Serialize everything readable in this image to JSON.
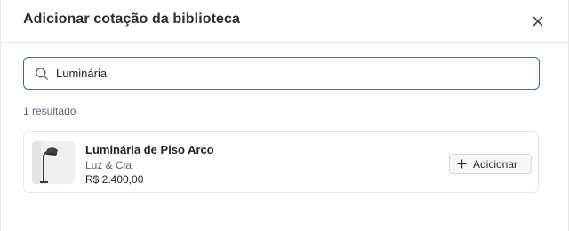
{
  "modal": {
    "title": "Adicionar cotação da biblioteca",
    "close_icon": "close-icon"
  },
  "search": {
    "icon": "search-icon",
    "value": "Luminária",
    "placeholder": ""
  },
  "results": {
    "count_label": "1 resultado",
    "items": [
      {
        "name": "Luminária de Piso Arco",
        "brand": "Luz & Cia",
        "price": "R$ 2.400,00",
        "image": "floor-lamp-thumbnail",
        "add_label": "Adicionar",
        "add_icon": "plus-icon"
      }
    ]
  },
  "colors": {
    "focus_border": "#2f6cc7",
    "border": "#e3e5e8",
    "button_bg": "#f6f7f8"
  }
}
